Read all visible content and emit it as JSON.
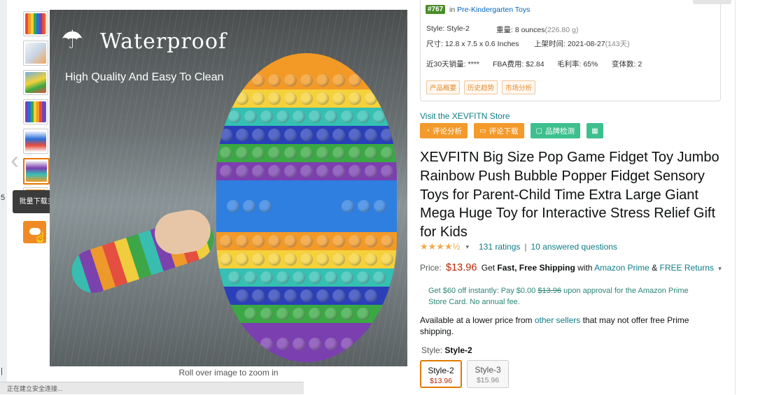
{
  "colors": {
    "accent_orange": "#f39a2b",
    "accent_green": "#3dbf8e",
    "price_red": "#b12704",
    "link_teal": "#0e7c86",
    "rank_green": "#4a8c2a"
  },
  "left_edge": {
    "char_top": "5",
    "char_bottom": "|"
  },
  "gallery": {
    "thumbnail_count": 8,
    "tooltip": "批量下载主图+视频",
    "download_icon": "cloud-download-icon",
    "prev_icon": "chevron-left-icon",
    "main_image_heading": "Waterproof",
    "main_image_subheading": "High Quality And Easy To Clean",
    "zoom_hint": "Roll over image to zoom in"
  },
  "status_bar": "正在建立安全连接...",
  "seller_panel": {
    "rank_badge": "#767",
    "rank_in": "in",
    "rank_category": "Pre-Kindergarten Toys",
    "style": "Style: Style-2",
    "weight_label": "重量:",
    "weight_value": "8 ounces",
    "weight_alt": "(226.80 g)",
    "size_label": "尺寸:",
    "size_value": "12.8 x 7.5 x 0.6 Inches",
    "listed_label": "上架时间:",
    "listed_value": "2021-08-27",
    "listed_days": "(143天)",
    "sales_label": "近30天销量:",
    "sales_value": "****",
    "fba_label": "FBA费用:",
    "fba_value": "$2.84",
    "margin_label": "毛利率:",
    "margin_value": "65%",
    "variants_label": "变体数:",
    "variants_value": "2",
    "tabs": [
      "产品概要",
      "历史趋势",
      "市场分析"
    ]
  },
  "store_link": "Visit the XEVFITN Store",
  "tools": {
    "review_analysis": "评论分析",
    "review_download": "评论下载",
    "brand_check": "品牌检测",
    "calculator_icon": "calculator-icon"
  },
  "product": {
    "title": "XEVFITN Big Size Pop Game Fidget Toy Jumbo Rainbow Push Bubble Popper Fidget Sensory Toys for Parent-Child Time Extra Large Giant Mega Huge Toy for Interactive Stress Relief Gift for Kids",
    "stars": "★★★★½",
    "rating_value": 4.5,
    "ratings": "131 ratings",
    "questions": "10 answered questions",
    "price_label": "Price:",
    "price": "$13.96",
    "shipping_prefix": "Get",
    "shipping_bold": "Fast, Free Shipping",
    "shipping_with": "with",
    "prime": "Amazon Prime",
    "amp": "&",
    "returns": "FREE Returns",
    "promo_text_1": "Get $60 off instantly: Pay $0.00",
    "promo_strike": "$13.96",
    "promo_text_2": "upon approval for the Amazon Prime Store Card. No annual fee.",
    "lower_price_1": "Available at a lower price from",
    "lower_price_link": "other sellers",
    "lower_price_2": "that may not offer free Prime shipping.",
    "style_label": "Style:",
    "style_selected": "Style-2",
    "options": [
      {
        "name": "Style-2",
        "price": "$13.96"
      },
      {
        "name": "Style-3",
        "price": "$15.96"
      }
    ]
  }
}
